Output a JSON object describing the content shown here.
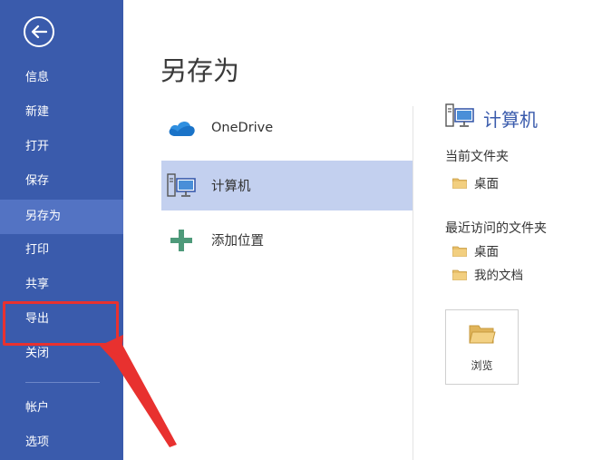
{
  "sidebar": {
    "back_icon": "back-arrow-icon",
    "items": [
      {
        "label": "信息"
      },
      {
        "label": "新建"
      },
      {
        "label": "打开"
      },
      {
        "label": "保存"
      },
      {
        "label": "另存为"
      },
      {
        "label": "打印"
      },
      {
        "label": "共享"
      },
      {
        "label": "导出"
      },
      {
        "label": "关闭"
      },
      {
        "label": "帐户"
      },
      {
        "label": "选项"
      }
    ],
    "active_index": 4,
    "colors": {
      "background": "#3a5bac",
      "active": "#5373c3"
    }
  },
  "main": {
    "title": "另存为",
    "locations": [
      {
        "label": "OneDrive",
        "icon": "cloud-icon"
      },
      {
        "label": "计算机",
        "icon": "computer-icon"
      },
      {
        "label": "添加位置",
        "icon": "plus-icon"
      }
    ],
    "selected_index": 1,
    "accent": "#3a5bac"
  },
  "right_panel": {
    "title": "计算机",
    "current_folder_label": "当前文件夹",
    "current_folders": [
      {
        "label": "桌面",
        "icon": "folder-icon"
      }
    ],
    "recent_label": "最近访问的文件夹",
    "recent_folders": [
      {
        "label": "桌面",
        "icon": "folder-icon"
      },
      {
        "label": "我的文档",
        "icon": "folder-icon"
      }
    ],
    "browse_label": "浏览"
  },
  "annotation": {
    "highlight_color": "#e8312f"
  }
}
